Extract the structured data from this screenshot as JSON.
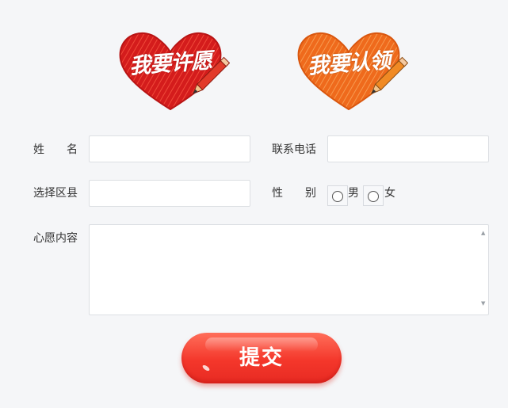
{
  "tabs": [
    {
      "label": "我要许愿",
      "color": "#d91b1b"
    },
    {
      "label": "我要认领",
      "color": "#f0701e"
    }
  ],
  "form": {
    "name_label": "姓　　名",
    "phone_label": "联系电话",
    "district_label": "选择区县",
    "gender_label": "性　　别",
    "gender_options": [
      "男",
      "女"
    ],
    "wish_label": "心愿内容",
    "name_value": "",
    "phone_value": "",
    "district_value": "",
    "wish_value": ""
  },
  "submit_label": "提交",
  "icons": {
    "pencil": "pencil-icon",
    "scroll_up": "▲",
    "scroll_down": "▼"
  }
}
